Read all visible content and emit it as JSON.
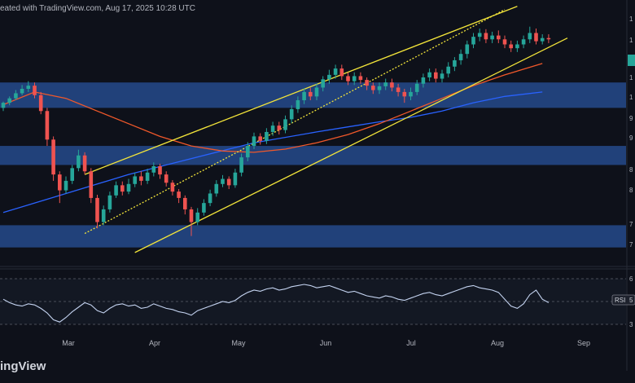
{
  "header": {
    "text": "eated with TradingView.com, Aug 17, 2025 10:28 UTC"
  },
  "logo": {
    "text": "ingView"
  },
  "colors": {
    "background": "#0e111a",
    "up": "#26a69a",
    "down": "#ef5350",
    "channel": "#f2e43a",
    "zone": "#254a8c",
    "ma_fast": "#f0582a",
    "ma_slow": "#2962ff",
    "rsi": "#c3d2ef"
  },
  "chart_data": {
    "type": "candlestick",
    "x_ticks": [
      "Mar",
      "Apr",
      "May",
      "Jun",
      "Jul",
      "Aug",
      "Sep"
    ],
    "y_tick_labels": [
      "1",
      "1",
      "1",
      "1",
      "9",
      "9",
      "8",
      "8",
      "7",
      "7"
    ],
    "rsi_label": "RSI",
    "rsi_value": "5",
    "rsi_tick_labels": [
      "6",
      "4",
      "3"
    ],
    "zones": [
      [
        0.95,
        0.99
      ],
      [
        0.86,
        0.89
      ],
      [
        0.73,
        0.765
      ]
    ],
    "candles": [
      [
        0.95,
        0.958,
        0.945,
        0.96
      ],
      [
        0.958,
        0.965,
        0.954,
        0.968
      ],
      [
        0.965,
        0.973,
        0.962,
        0.978
      ],
      [
        0.973,
        0.98,
        0.97,
        0.986
      ],
      [
        0.98,
        0.985,
        0.975,
        0.992
      ],
      [
        0.985,
        0.97,
        0.965,
        0.99
      ],
      [
        0.97,
        0.945,
        0.94,
        0.975
      ],
      [
        0.945,
        0.9,
        0.89,
        0.95
      ],
      [
        0.9,
        0.845,
        0.835,
        0.905
      ],
      [
        0.845,
        0.82,
        0.8,
        0.85
      ],
      [
        0.82,
        0.835,
        0.815,
        0.842
      ],
      [
        0.835,
        0.855,
        0.83,
        0.86
      ],
      [
        0.855,
        0.875,
        0.85,
        0.884
      ],
      [
        0.875,
        0.85,
        0.845,
        0.88
      ],
      [
        0.85,
        0.808,
        0.8,
        0.855
      ],
      [
        0.808,
        0.77,
        0.76,
        0.813
      ],
      [
        0.77,
        0.79,
        0.765,
        0.796
      ],
      [
        0.79,
        0.812,
        0.785,
        0.818
      ],
      [
        0.812,
        0.828,
        0.808,
        0.834
      ],
      [
        0.828,
        0.818,
        0.812,
        0.834
      ],
      [
        0.818,
        0.83,
        0.814,
        0.838
      ],
      [
        0.83,
        0.842,
        0.825,
        0.848
      ],
      [
        0.842,
        0.835,
        0.828,
        0.85
      ],
      [
        0.835,
        0.848,
        0.83,
        0.854
      ],
      [
        0.848,
        0.858,
        0.842,
        0.864
      ],
      [
        0.858,
        0.845,
        0.838,
        0.862
      ],
      [
        0.845,
        0.832,
        0.826,
        0.85
      ],
      [
        0.832,
        0.818,
        0.812,
        0.836
      ],
      [
        0.818,
        0.808,
        0.8,
        0.822
      ],
      [
        0.808,
        0.79,
        0.782,
        0.812
      ],
      [
        0.79,
        0.77,
        0.748,
        0.794
      ],
      [
        0.77,
        0.785,
        0.765,
        0.792
      ],
      [
        0.785,
        0.8,
        0.78,
        0.806
      ],
      [
        0.8,
        0.815,
        0.795,
        0.821
      ],
      [
        0.815,
        0.83,
        0.81,
        0.836
      ],
      [
        0.83,
        0.838,
        0.825,
        0.844
      ],
      [
        0.838,
        0.828,
        0.822,
        0.842
      ],
      [
        0.828,
        0.848,
        0.824,
        0.854
      ],
      [
        0.848,
        0.872,
        0.842,
        0.878
      ],
      [
        0.872,
        0.89,
        0.866,
        0.896
      ],
      [
        0.89,
        0.905,
        0.885,
        0.911
      ],
      [
        0.905,
        0.898,
        0.892,
        0.91
      ],
      [
        0.898,
        0.912,
        0.893,
        0.918
      ],
      [
        0.912,
        0.922,
        0.906,
        0.928
      ],
      [
        0.922,
        0.915,
        0.908,
        0.928
      ],
      [
        0.915,
        0.932,
        0.91,
        0.938
      ],
      [
        0.932,
        0.948,
        0.926,
        0.954
      ],
      [
        0.948,
        0.962,
        0.942,
        0.968
      ],
      [
        0.962,
        0.975,
        0.956,
        0.981
      ],
      [
        0.975,
        0.968,
        0.962,
        0.982
      ],
      [
        0.968,
        0.982,
        0.962,
        0.988
      ],
      [
        0.982,
        0.995,
        0.976,
        1.0
      ],
      [
        0.995,
        1.002,
        0.988,
        1.01
      ],
      [
        1.002,
        1.012,
        0.996,
        1.018
      ],
      [
        1.012,
        1.0,
        0.994,
        1.018
      ],
      [
        1.0,
        0.992,
        0.986,
        1.006
      ],
      [
        0.992,
        1.0,
        0.986,
        1.006
      ],
      [
        1.0,
        0.994,
        0.988,
        1.006
      ],
      [
        0.994,
        0.985,
        0.978,
        0.998
      ],
      [
        0.985,
        0.978,
        0.972,
        0.99
      ],
      [
        0.978,
        0.984,
        0.972,
        0.99
      ],
      [
        0.984,
        0.99,
        0.978,
        0.996
      ],
      [
        0.99,
        0.982,
        0.976,
        0.996
      ],
      [
        0.982,
        0.975,
        0.968,
        0.988
      ],
      [
        0.975,
        0.968,
        0.958,
        0.98
      ],
      [
        0.968,
        0.975,
        0.962,
        0.982
      ],
      [
        0.975,
        0.988,
        0.97,
        0.994
      ],
      [
        0.988,
        0.998,
        0.982,
        1.004
      ],
      [
        0.998,
        1.006,
        0.992,
        1.012
      ],
      [
        1.006,
        0.996,
        0.99,
        1.012
      ],
      [
        0.996,
        1.004,
        0.99,
        1.01
      ],
      [
        1.004,
        1.015,
        0.998,
        1.022
      ],
      [
        1.015,
        1.025,
        1.008,
        1.03
      ],
      [
        1.025,
        1.035,
        1.018,
        1.042
      ],
      [
        1.035,
        1.05,
        1.028,
        1.056
      ],
      [
        1.05,
        1.062,
        1.044,
        1.068
      ],
      [
        1.062,
        1.068,
        1.055,
        1.075
      ],
      [
        1.068,
        1.058,
        1.052,
        1.074
      ],
      [
        1.058,
        1.064,
        1.052,
        1.07
      ],
      [
        1.064,
        1.058,
        1.052,
        1.072
      ],
      [
        1.058,
        1.05,
        1.044,
        1.064
      ],
      [
        1.05,
        1.044,
        1.038,
        1.056
      ],
      [
        1.044,
        1.05,
        1.038,
        1.056
      ],
      [
        1.05,
        1.058,
        1.044,
        1.064
      ],
      [
        1.058,
        1.068,
        1.052,
        1.078
      ],
      [
        1.068,
        1.055,
        1.05,
        1.075
      ],
      [
        1.055,
        1.06,
        1.05,
        1.066
      ],
      [
        1.06,
        1.058,
        1.052,
        1.066
      ]
    ],
    "ma_fast": [
      [
        0,
        0.955
      ],
      [
        5,
        0.975
      ],
      [
        10,
        0.965
      ],
      [
        15,
        0.945
      ],
      [
        20,
        0.925
      ],
      [
        25,
        0.905
      ],
      [
        30,
        0.89
      ],
      [
        35,
        0.882
      ],
      [
        40,
        0.88
      ],
      [
        45,
        0.885
      ],
      [
        50,
        0.895
      ],
      [
        55,
        0.908
      ],
      [
        60,
        0.925
      ],
      [
        65,
        0.945
      ],
      [
        70,
        0.965
      ],
      [
        75,
        0.985
      ],
      [
        80,
        1.002
      ],
      [
        86,
        1.02
      ]
    ],
    "ma_slow": [
      [
        0,
        0.785
      ],
      [
        10,
        0.815
      ],
      [
        20,
        0.845
      ],
      [
        30,
        0.87
      ],
      [
        40,
        0.895
      ],
      [
        50,
        0.912
      ],
      [
        55,
        0.92
      ],
      [
        60,
        0.928
      ],
      [
        65,
        0.935
      ],
      [
        70,
        0.945
      ],
      [
        75,
        0.958
      ],
      [
        80,
        0.968
      ],
      [
        86,
        0.975
      ]
    ],
    "channel_upper": [
      [
        13,
        0.845
      ],
      [
        82,
        1.11
      ]
    ],
    "channel_lower": [
      [
        21,
        0.722
      ],
      [
        90,
        1.06
      ]
    ],
    "channel_mid": [
      [
        13,
        0.752
      ],
      [
        80,
        1.105
      ]
    ],
    "rsi_values": [
      52,
      49,
      47,
      46,
      48,
      47,
      44,
      40,
      34,
      32,
      36,
      41,
      45,
      49,
      47,
      42,
      40,
      44,
      47,
      48,
      46,
      47,
      44,
      45,
      48,
      46,
      44,
      43,
      41,
      40,
      38,
      42,
      44,
      46,
      48,
      50,
      49,
      51,
      55,
      58,
      60,
      59,
      61,
      62,
      60,
      61,
      63,
      64,
      65,
      64,
      62,
      63,
      64,
      62,
      60,
      58,
      59,
      57,
      55,
      54,
      53,
      55,
      54,
      52,
      51,
      53,
      55,
      57,
      58,
      56,
      55,
      57,
      59,
      61,
      63,
      64,
      62,
      61,
      60,
      58,
      52,
      46,
      44,
      48,
      56,
      60,
      52,
      49
    ]
  }
}
